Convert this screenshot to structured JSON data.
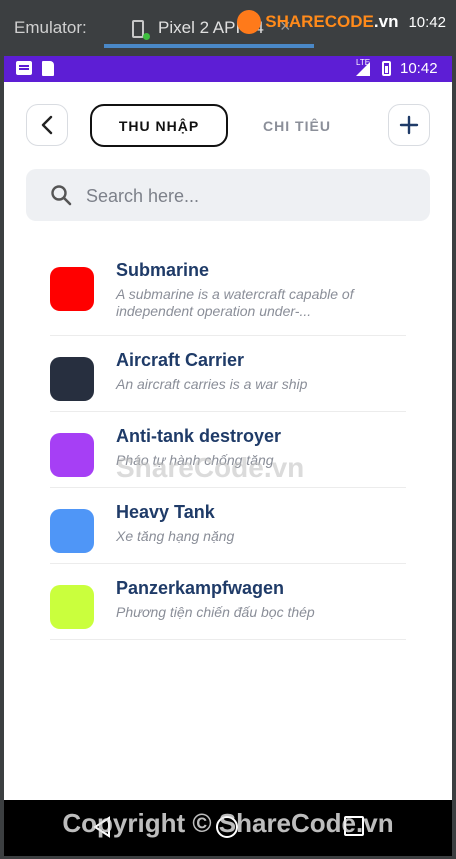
{
  "emulator": {
    "title": "Emulator:",
    "tab_label": "Pixel 2 API 24",
    "close_glyph": "×",
    "watermark_text": "SHARECODE",
    "watermark_domain": ".vn",
    "watermark_time": "10:42"
  },
  "status_bar": {
    "time": "10:42",
    "network": "LTE",
    "background": "#5d1ed5"
  },
  "header": {
    "tab_income": "THU NHẬP",
    "tab_expense": "CHI TIÊU"
  },
  "search": {
    "placeholder": "Search here..."
  },
  "items": [
    {
      "name": "Submarine",
      "desc": "A submarine is a watercraft capable of independent operation under-...",
      "color": "#ff0000"
    },
    {
      "name": "Aircraft Carrier",
      "desc": "An aircraft carries is a war ship",
      "color": "#272f3f"
    },
    {
      "name": "Anti-tank destroyer",
      "desc": "Pháo tự hành chống tăng",
      "color": "#a63ff5"
    },
    {
      "name": "Heavy Tank",
      "desc": "Xe tăng hạng nặng",
      "color": "#4f96f7"
    },
    {
      "name": "Panzerkampfwagen",
      "desc": "Phương tiện chiến đấu bọc thép",
      "color": "#caff3d"
    }
  ],
  "watermark_center": "ShareCode.vn",
  "copyright": "Copyright © ShareCode.vn"
}
